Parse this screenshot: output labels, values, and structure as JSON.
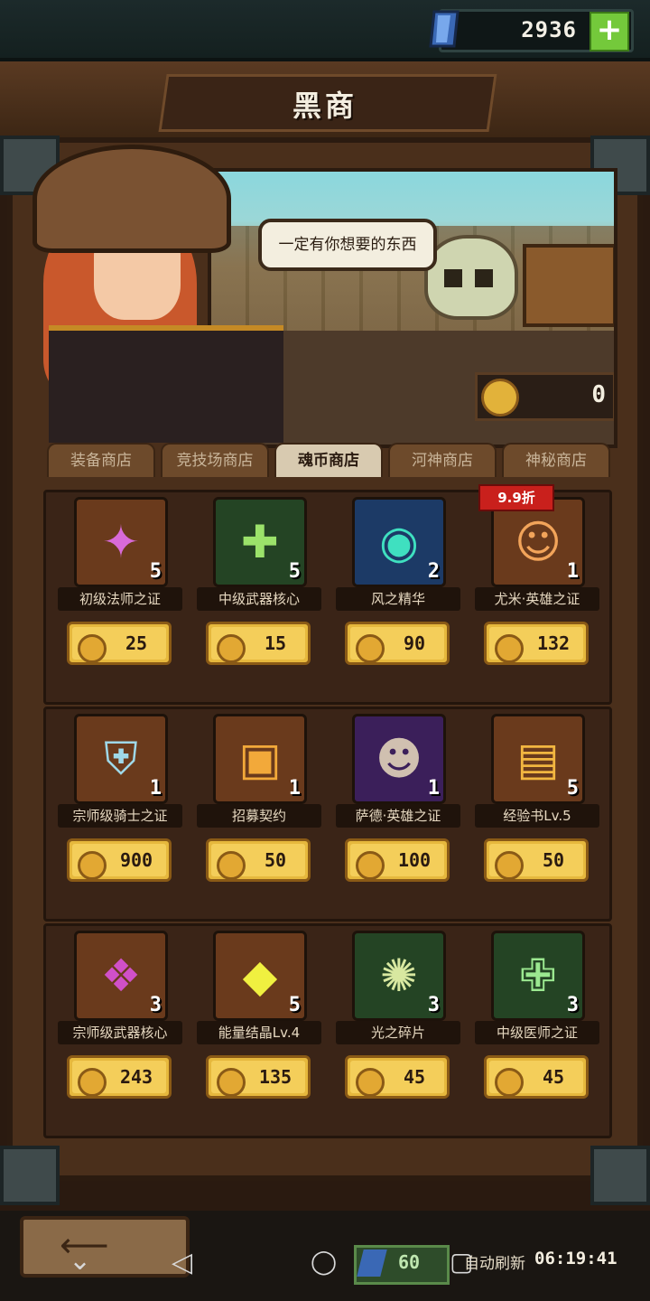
{
  "header": {
    "gem_icon": "blue-gem-icon",
    "gem_count": "2936",
    "add_label": "+",
    "title": "黑商"
  },
  "hero": {
    "speech": "一定有你想要的东西",
    "soul_coin_icon": "soul-coin-icon",
    "soul_coin_count": "0"
  },
  "tabs": [
    {
      "label": "装备商店",
      "active": false
    },
    {
      "label": "竞技场商店",
      "active": false
    },
    {
      "label": "魂币商店",
      "active": true
    },
    {
      "label": "河神商店",
      "active": false
    },
    {
      "label": "神秘商店",
      "active": false
    }
  ],
  "items": [
    {
      "name": "初级法师之证",
      "qty": "5",
      "price": "25",
      "icon": "mage-badge-icon",
      "bg": "brown"
    },
    {
      "name": "中级武器核心",
      "qty": "5",
      "price": "15",
      "icon": "weapon-core-icon",
      "bg": "green"
    },
    {
      "name": "风之精华",
      "qty": "2",
      "price": "90",
      "icon": "wind-essence-icon",
      "bg": "blue"
    },
    {
      "name": "尤米·英雄之证",
      "qty": "1",
      "price": "132",
      "icon": "hero-yumi-icon",
      "bg": "brown",
      "discount": "9.9折"
    },
    {
      "name": "宗师级骑士之证",
      "qty": "1",
      "price": "900",
      "icon": "knight-badge-icon",
      "bg": "brown"
    },
    {
      "name": "招募契约",
      "qty": "1",
      "price": "50",
      "icon": "recruit-contract-icon",
      "bg": "brown"
    },
    {
      "name": "萨德·英雄之证",
      "qty": "1",
      "price": "100",
      "icon": "hero-sade-icon",
      "bg": "purple"
    },
    {
      "name": "经验书Lv.5",
      "qty": "5",
      "price": "50",
      "icon": "exp-book-icon",
      "bg": "brown"
    },
    {
      "name": "宗师级武器核心",
      "qty": "3",
      "price": "243",
      "icon": "master-weapon-core-icon",
      "bg": "brown"
    },
    {
      "name": "能量结晶Lv.4",
      "qty": "5",
      "price": "135",
      "icon": "energy-crystal-icon",
      "bg": "brown"
    },
    {
      "name": "光之碎片",
      "qty": "3",
      "price": "45",
      "icon": "light-shard-icon",
      "bg": "green"
    },
    {
      "name": "中级医师之证",
      "qty": "3",
      "price": "45",
      "icon": "healer-badge-icon",
      "bg": "green"
    }
  ],
  "footer": {
    "back_icon": "back-arrow-icon",
    "energy_count": "60",
    "refresh_label": "自动刷新",
    "refresh_timer": "06:19:41"
  },
  "colors": {
    "accent_gold": "#f4ce5a",
    "discount_red": "#c9201c",
    "gem_blue": "#3a68b5",
    "plus_green": "#74c93b"
  }
}
